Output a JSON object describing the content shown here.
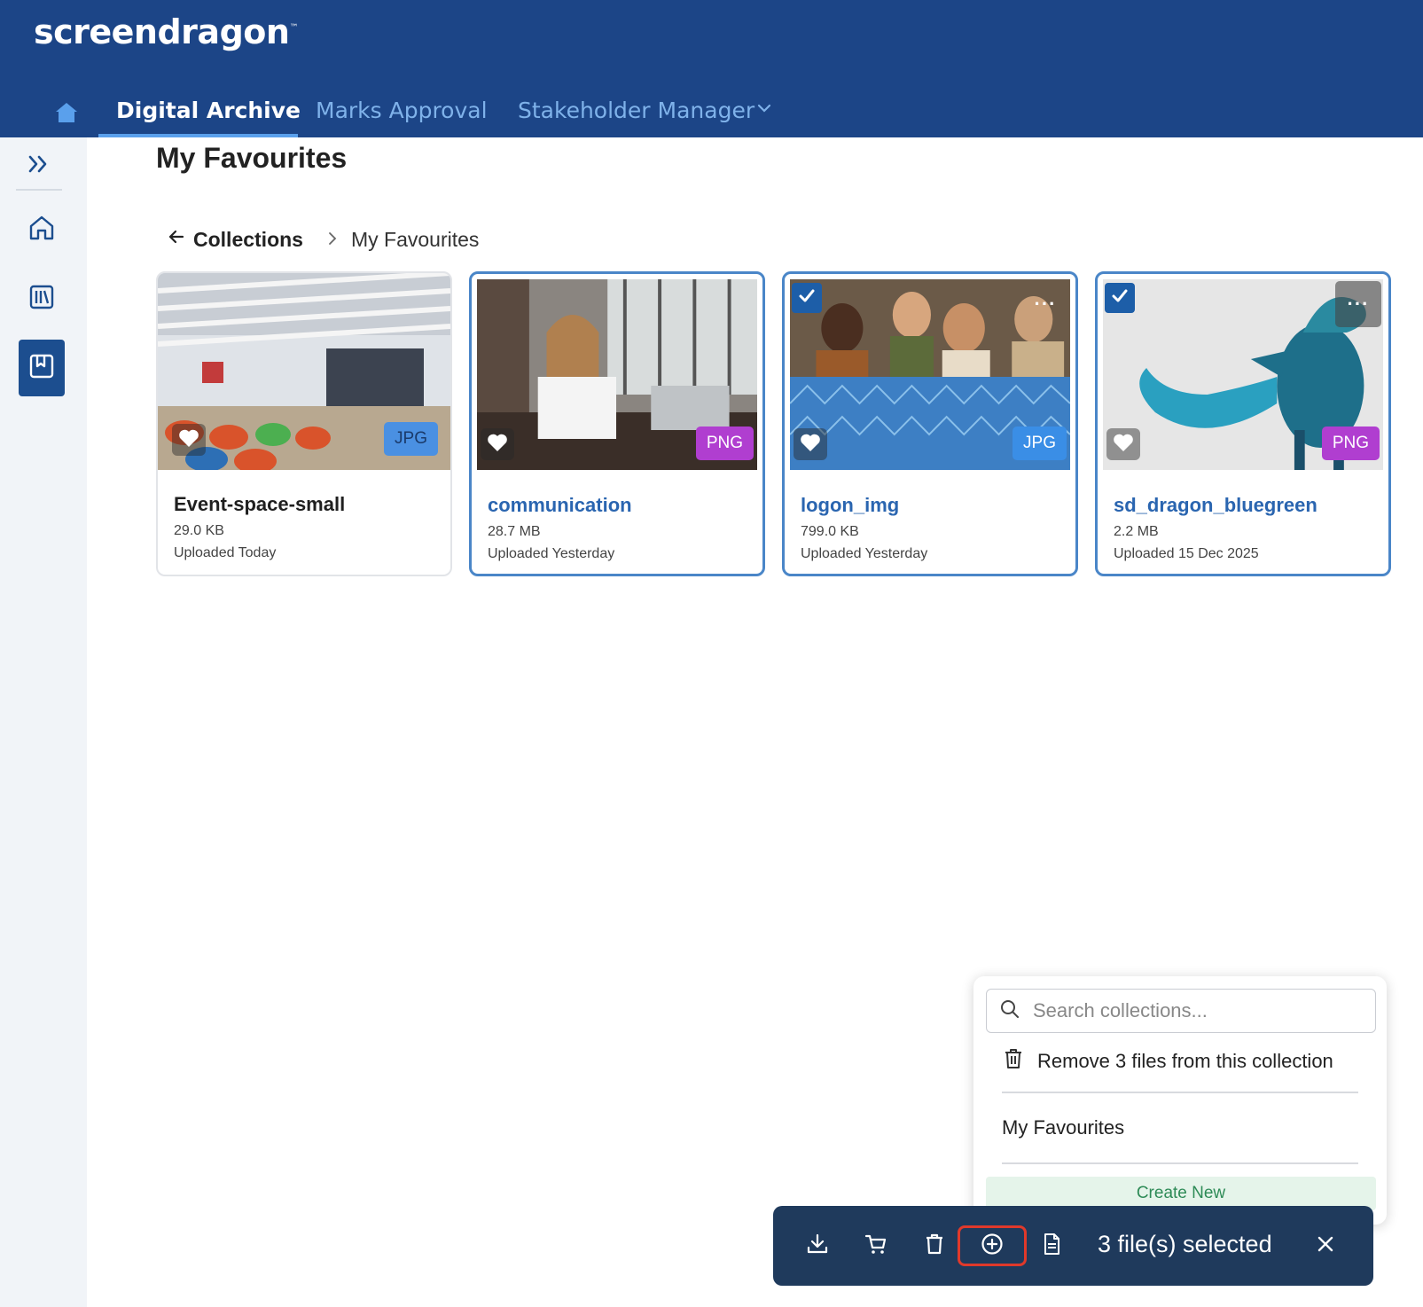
{
  "header": {
    "logo_text": "screendragon",
    "logo_mark": "™",
    "tabs": [
      {
        "label": "Digital Archive",
        "active": true
      },
      {
        "label": "Marks Approval",
        "active": false
      },
      {
        "label": "Stakeholder Manager",
        "active": false
      }
    ]
  },
  "sidebar": {
    "items": [
      {
        "icon": "expand-icon"
      },
      {
        "icon": "home-icon"
      },
      {
        "icon": "library-icon"
      },
      {
        "icon": "collections-icon",
        "active": true
      }
    ]
  },
  "page": {
    "title": "My Favourites",
    "breadcrumb": {
      "back_label": "Collections",
      "current": "My Favourites"
    }
  },
  "cards": [
    {
      "name": "Event-space-small",
      "size": "29.0 KB",
      "uploaded": "Uploaded Today",
      "type": "JPG",
      "selected": false
    },
    {
      "name": "communication",
      "size": "28.7 MB",
      "uploaded": "Uploaded Yesterday",
      "type": "PNG",
      "selected": false
    },
    {
      "name": "logon_img",
      "size": "799.0 KB",
      "uploaded": "Uploaded Yesterday",
      "type": "JPG",
      "selected": true
    },
    {
      "name": "sd_dragon_bluegreen",
      "size": "2.2 MB",
      "uploaded": "Uploaded 15 Dec 2025",
      "type": "PNG",
      "selected": true
    }
  ],
  "more_label": "···",
  "popover": {
    "search_placeholder": "Search collections...",
    "remove_label": "Remove 3 files from this collection",
    "collections": [
      "My Favourites"
    ],
    "create_new_label": "Create New"
  },
  "selection_bar": {
    "count_label": "3 file(s) selected",
    "actions": [
      "download-icon",
      "cart-icon",
      "trash-icon",
      "add-to-collection-icon",
      "document-icon"
    ]
  },
  "colors": {
    "header_bg": "#1c4587",
    "accent": "#2a65b0",
    "jpg_badge": "#3a8ee6",
    "png_badge": "#b03ed0",
    "selection_bar": "#1f3a5c",
    "create_new_text": "#2e8b57"
  }
}
